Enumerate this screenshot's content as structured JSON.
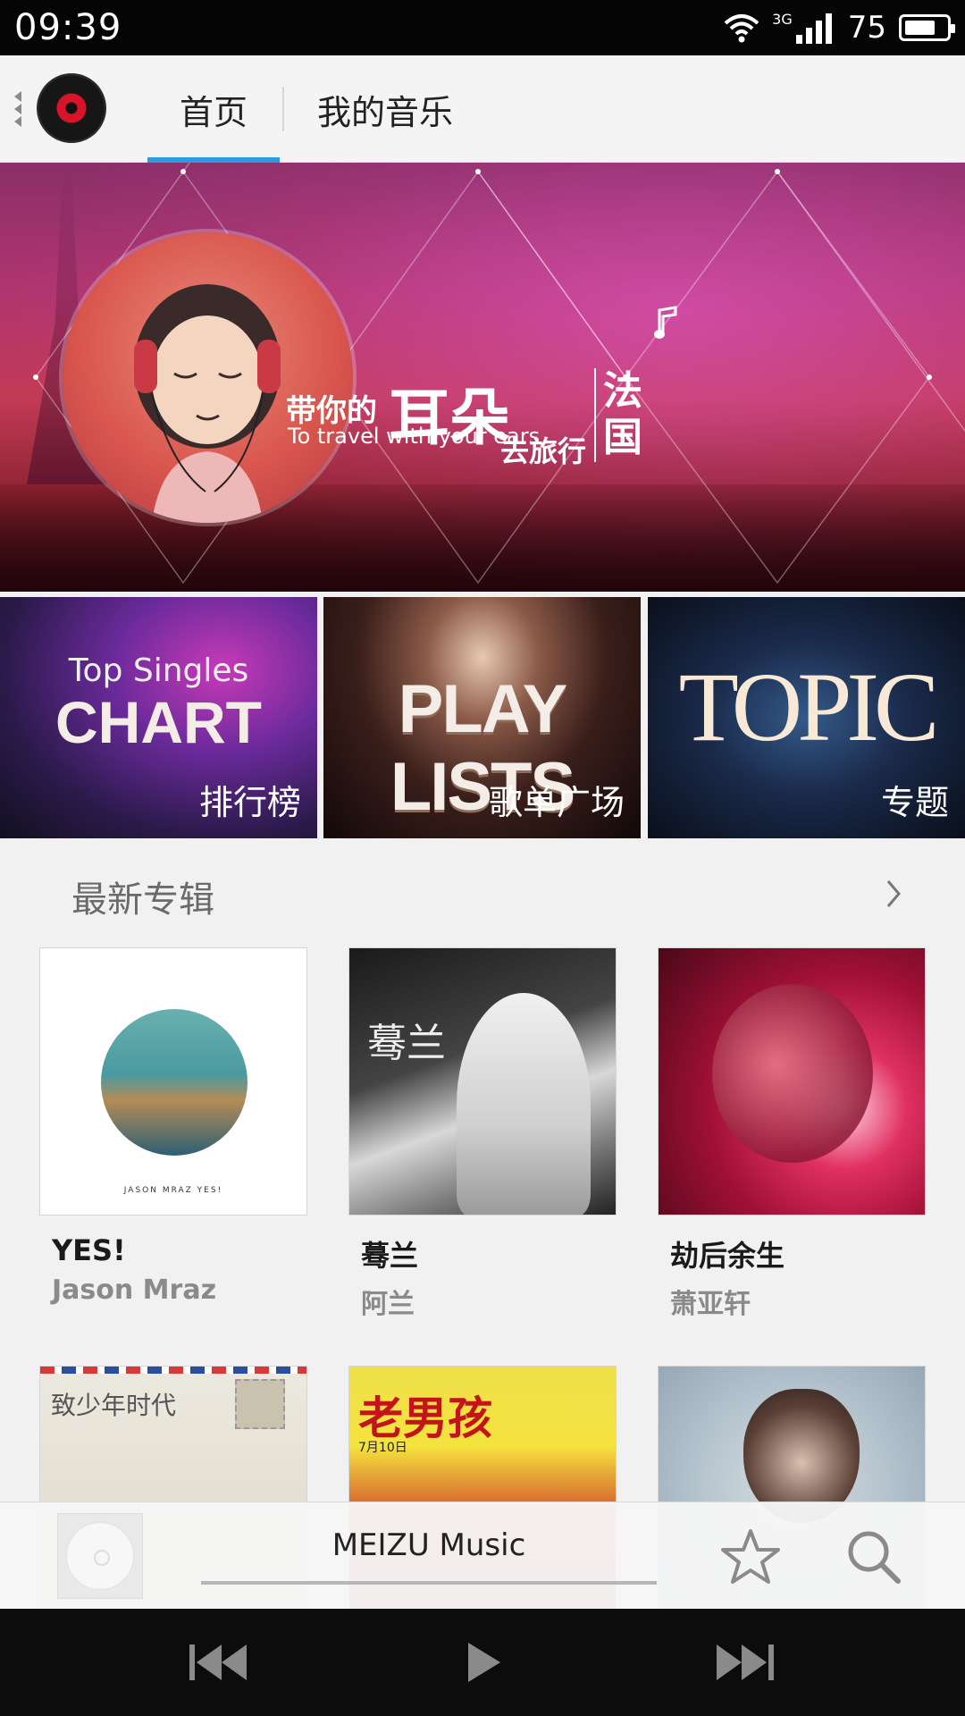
{
  "status_bar": {
    "time": "09:39",
    "network": "3G",
    "battery": "75",
    "battery_level": 0.75
  },
  "header": {
    "tabs": [
      {
        "label": "首页",
        "active": true
      },
      {
        "label": "我的音乐",
        "active": false
      }
    ],
    "accent_color": "#2d9be0"
  },
  "banner": {
    "headline_prefix": "带你的",
    "headline_big": "耳朵",
    "subtitle": "To travel with your ears",
    "headline_suffix": "去旅行",
    "destination": "法国"
  },
  "categories": [
    {
      "title_top": "Top Singles",
      "title_main": "CHART",
      "label": "排行榜"
    },
    {
      "title_top": "",
      "title_main": "PLAY LISTS",
      "label": "歌单广场"
    },
    {
      "title_top": "",
      "title_main": "TOPIC",
      "label": "专题"
    }
  ],
  "latest_albums": {
    "title": "最新专辑",
    "more_icon": "chevron-right-icon",
    "albums": [
      {
        "title": "YES!",
        "artist": "Jason Mraz",
        "cover_text": "JASON MRAZ YES!"
      },
      {
        "title": "蓦兰",
        "artist": "阿兰",
        "cover_text": "蓦兰"
      },
      {
        "title": "劫后余生",
        "artist": "萧亚轩"
      }
    ],
    "more_albums": [
      {
        "cover_text": "致少年时代"
      },
      {
        "cover_text": "老男孩",
        "cover_subtext": "7月10日"
      },
      {}
    ]
  },
  "mini_player": {
    "title": "MEIZU Music",
    "progress": 0.0,
    "favorite_icon": "star-icon",
    "search_icon": "search-icon"
  },
  "controls": {
    "prev_icon": "previous-icon",
    "play_icon": "play-icon",
    "next_icon": "next-icon"
  }
}
